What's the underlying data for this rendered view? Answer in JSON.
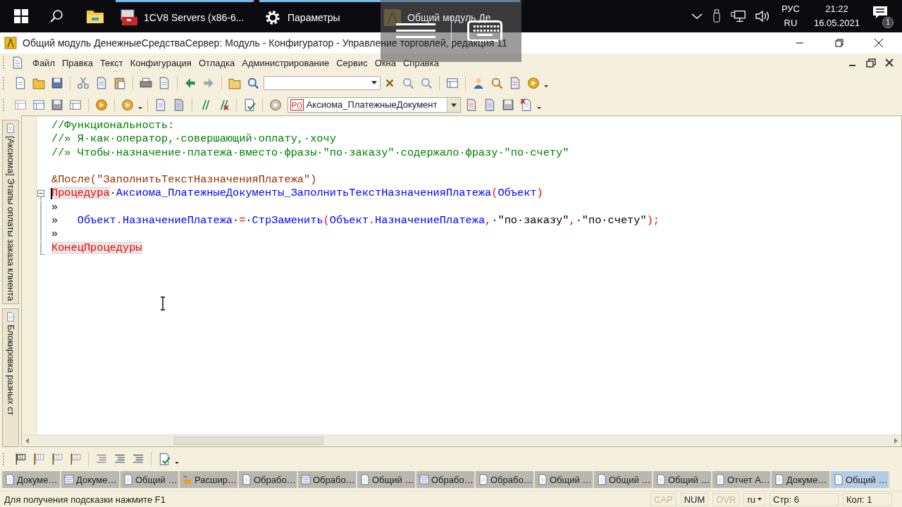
{
  "taskbar": {
    "apps": [
      {
        "label": "1CV8 Servers (x86-6...",
        "running": true
      },
      {
        "label": "Параметры",
        "running": true
      },
      {
        "label": "Общий модуль Де...",
        "running": true
      }
    ],
    "language": [
      "РУС",
      "RU"
    ],
    "time": "21:22",
    "date": "16.05.2021",
    "notifications": "1"
  },
  "window": {
    "title": "Общий модуль ДенежныеСредстваСервер: Модуль - Конфигуратор - Управление торговлей, редакция 11"
  },
  "menu": [
    "Файл",
    "Правка",
    "Текст",
    "Конфигурация",
    "Отладка",
    "Администрирование",
    "Сервис",
    "Окна",
    "Справка"
  ],
  "toolbar": {
    "method_combo": {
      "icon_text": "P()",
      "value": "Аксиома_ПлатежныеДокумент"
    }
  },
  "side_tabs": [
    "[Аксиома] Этапы оплаты заказа клиента",
    "Блокировка разных ст"
  ],
  "code": [
    {
      "kind": "text",
      "tokens": [
        {
          "kind": "comment",
          "text": "//Функциональность:"
        }
      ]
    },
    {
      "kind": "text",
      "tokens": [
        {
          "kind": "comment",
          "text": "//» Я·как·оператор,·совершающий·оплату,·хочу"
        }
      ]
    },
    {
      "kind": "text",
      "tokens": [
        {
          "kind": "comment",
          "text": "//» Чтобы·назначение·платежа·вместо·фразы·\"по·заказу\"·содержало·фразу·\"по·счету\""
        }
      ]
    },
    {
      "kind": "blank"
    },
    {
      "kind": "text",
      "tokens": [
        {
          "kind": "directive",
          "text": "&После(\"ЗаполнитьТекстНазначенияПлатежа\")"
        }
      ]
    },
    {
      "kind": "fold_start",
      "caret": true,
      "tokens": [
        {
          "kind": "keyword",
          "text": "Процедура"
        },
        {
          "kind": "plain",
          "text": "·"
        },
        {
          "kind": "ident",
          "text": "Аксиома_ПлатежныеДокументы_ЗаполнитьТекстНазначенияПлатежа"
        },
        {
          "kind": "punct",
          "text": "("
        },
        {
          "kind": "ident",
          "text": "Объект"
        },
        {
          "kind": "punct",
          "text": ")"
        }
      ]
    },
    {
      "kind": "fold_body",
      "tokens": [
        {
          "kind": "plain",
          "text": "»"
        }
      ]
    },
    {
      "kind": "fold_body",
      "tokens": [
        {
          "kind": "plain",
          "text": "»   "
        },
        {
          "kind": "ident",
          "text": "Объект"
        },
        {
          "kind": "punct",
          "text": "."
        },
        {
          "kind": "ident",
          "text": "НазначениеПлатежа"
        },
        {
          "kind": "plain",
          "text": "·"
        },
        {
          "kind": "punct",
          "text": "="
        },
        {
          "kind": "plain",
          "text": "·"
        },
        {
          "kind": "ident",
          "text": "СтрЗаменить"
        },
        {
          "kind": "punct",
          "text": "("
        },
        {
          "kind": "ident",
          "text": "Объект"
        },
        {
          "kind": "punct",
          "text": "."
        },
        {
          "kind": "ident",
          "text": "НазначениеПлатежа"
        },
        {
          "kind": "punct",
          "text": ","
        },
        {
          "kind": "plain",
          "text": "·\"по·заказу\""
        },
        {
          "kind": "punct",
          "text": ","
        },
        {
          "kind": "plain",
          "text": "·\"по·счету\""
        },
        {
          "kind": "punct",
          "text": ");"
        }
      ]
    },
    {
      "kind": "fold_body",
      "tokens": [
        {
          "kind": "plain",
          "text": "»"
        }
      ]
    },
    {
      "kind": "fold_end",
      "tokens": [
        {
          "kind": "keyword",
          "text": "КонецПроцедуры"
        }
      ]
    }
  ],
  "window_tabs": [
    {
      "label": "Докуме…",
      "selected": false
    },
    {
      "label": "Докуме…",
      "selected": false
    },
    {
      "label": "Общий …",
      "selected": false
    },
    {
      "label": "Расшир…",
      "selected": false
    },
    {
      "label": "Обрабо…",
      "selected": false
    },
    {
      "label": "Обрабо…",
      "selected": false
    },
    {
      "label": "Общий …",
      "selected": false
    },
    {
      "label": "Обрабо…",
      "selected": false
    },
    {
      "label": "Обрабо…",
      "selected": false
    },
    {
      "label": "Общий …",
      "selected": false
    },
    {
      "label": "Общий …",
      "selected": false
    },
    {
      "label": "Общий …",
      "selected": false
    },
    {
      "label": "Отчет А…",
      "selected": false
    },
    {
      "label": "Докуме…",
      "selected": false
    },
    {
      "label": "Общий …",
      "selected": true
    }
  ],
  "status_bar": {
    "hint": "Для получения подсказки нажмите F1",
    "indicators": [
      {
        "label": "CAP",
        "on": false
      },
      {
        "label": "NUM",
        "on": true
      },
      {
        "label": "OVR",
        "on": false
      }
    ],
    "language": "ru",
    "line": "Стр: 6",
    "column": "Кол: 1"
  }
}
